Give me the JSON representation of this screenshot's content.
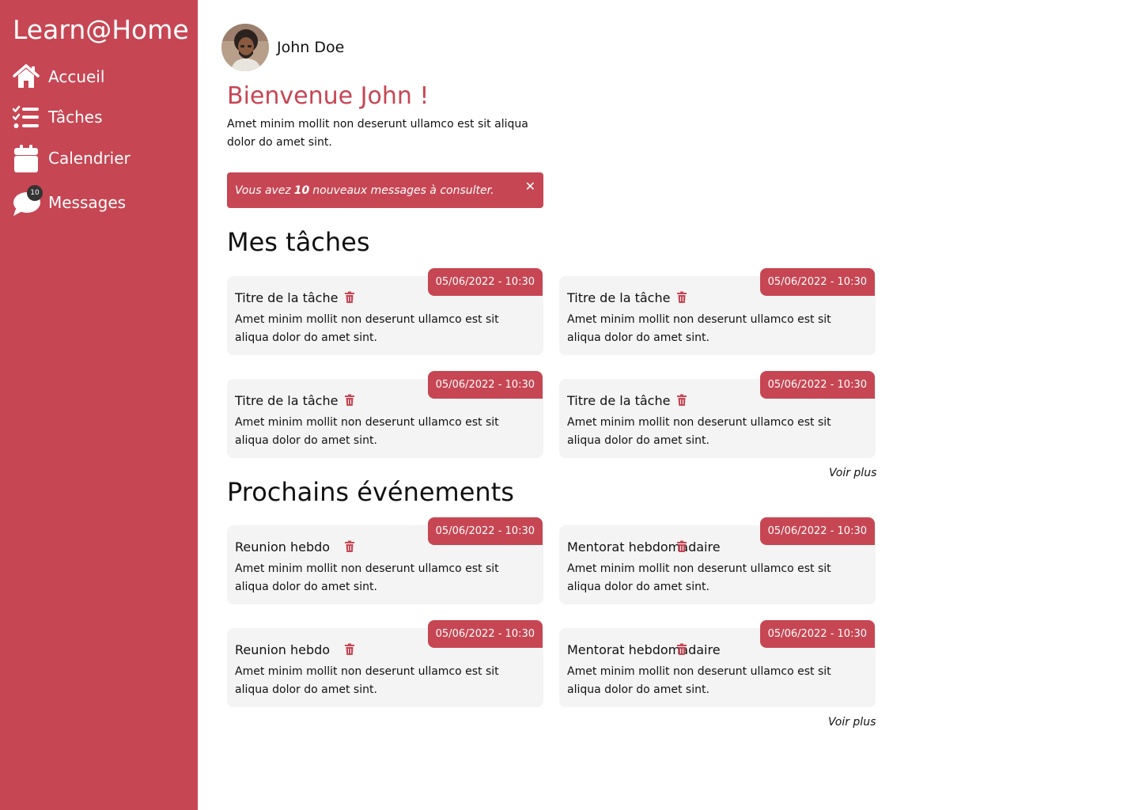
{
  "sidebar": {
    "brand": "Learn@Home",
    "items": [
      {
        "label": "Accueil",
        "icon": "home-icon"
      },
      {
        "label": "Tâches",
        "icon": "task-list-icon"
      },
      {
        "label": "Calendrier",
        "icon": "calendar-icon"
      },
      {
        "label": "Messages",
        "icon": "chat-bubble-icon",
        "badge": "10"
      }
    ]
  },
  "profile": {
    "name": "John Doe"
  },
  "welcome": {
    "title": "Bienvenue John !",
    "text": "Amet minim mollit non deserunt ullamco est sit aliqua dolor do amet sint."
  },
  "alert": {
    "prefix": "Vous avez",
    "count": "10",
    "suffix": "nouveaux messages à consulter.",
    "close": "✕"
  },
  "tasks": {
    "title": "Mes tâches",
    "items": [
      {
        "title": "Titre de la tâche",
        "date": "05/06/2022 - 10:30",
        "body": "Amet minim mollit non deserunt ullamco est sit aliqua dolor do amet sint."
      },
      {
        "title": "Titre de la tâche",
        "date": "05/06/2022 - 10:30",
        "body": "Amet minim mollit non deserunt ullamco est sit aliqua dolor do amet sint."
      },
      {
        "title": "Titre de la tâche",
        "date": "05/06/2022 - 10:30",
        "body": "Amet minim mollit non deserunt ullamco est sit aliqua dolor do amet sint."
      },
      {
        "title": "Titre de la tâche",
        "date": "05/06/2022 - 10:30",
        "body": "Amet minim mollit non deserunt ullamco est sit aliqua dolor do amet sint."
      }
    ],
    "more": "Voir plus"
  },
  "events": {
    "title": "Prochains événements",
    "items": [
      {
        "title": "Reunion hebdo",
        "date": "05/06/2022 - 10:30",
        "body": "Amet minim mollit non deserunt ullamco est sit aliqua dolor do amet sint."
      },
      {
        "title": "Mentorat hebdomadaire",
        "date": "05/06/2022 - 10:30",
        "body": "Amet minim mollit non deserunt ullamco est sit aliqua dolor do amet sint."
      },
      {
        "title": "Reunion hebdo",
        "date": "05/06/2022 - 10:30",
        "body": "Amet minim mollit non deserunt ullamco est sit aliqua dolor do amet sint."
      },
      {
        "title": "Mentorat hebdomadaire",
        "date": "05/06/2022 - 10:30",
        "body": "Amet minim mollit non deserunt ullamco est sit aliqua dolor do amet sint."
      }
    ],
    "more": "Voir plus"
  },
  "colors": {
    "accent": "#c74653",
    "card_bg": "#f4f4f4",
    "badge": "#333333"
  }
}
